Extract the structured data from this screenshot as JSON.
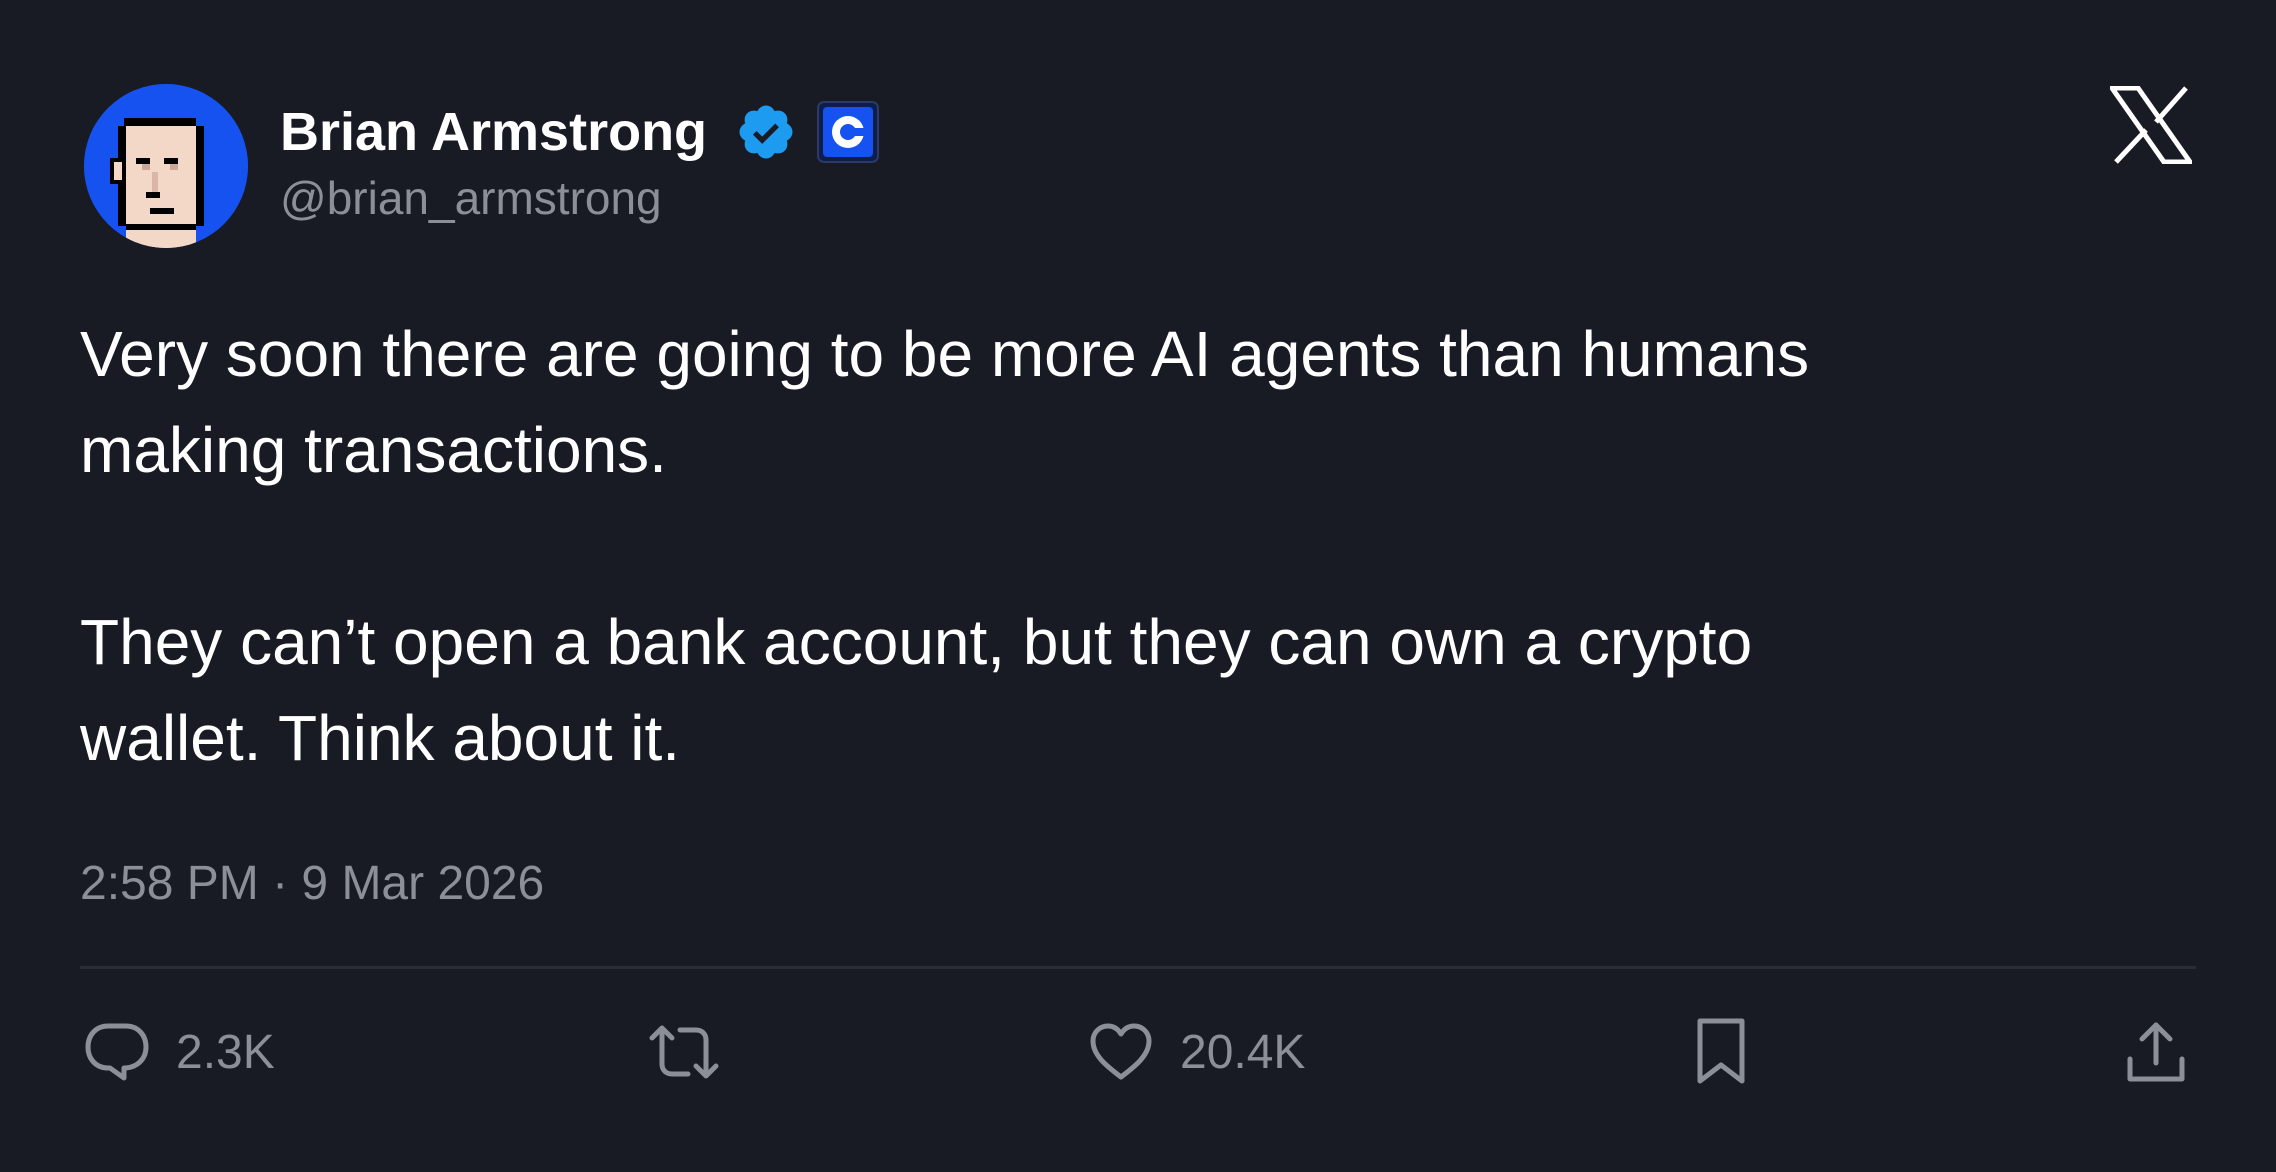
{
  "author": {
    "display_name": "Brian Armstrong",
    "handle": "@brian_armstrong",
    "avatar_icon": "pixel-portrait-avatar",
    "verified_icon": "verified-badge-icon",
    "affiliate_icon": "coinbase-logo-icon"
  },
  "brand_icon": "x-logo-icon",
  "tweet": {
    "paragraph_1": "Very soon there are going to be more AI agents than humans\nmaking transactions.",
    "paragraph_2": "They can’t open a bank account, but they can own a crypto\nwallet. Think about it.",
    "timestamp": "2:58 PM · 9 Mar 2026"
  },
  "actions": {
    "reply_count": "2.3K",
    "like_count": "20.4K",
    "reply_icon": "comment-icon",
    "retweet_icon": "retweet-icon",
    "like_icon": "heart-icon",
    "bookmark_icon": "bookmark-icon",
    "share_icon": "share-icon"
  },
  "colors": {
    "background": "#181b23",
    "text": "#ffffff",
    "muted": "#8b8f98",
    "verified": "#1d9bf0",
    "coinbase_blue": "#1652f0"
  }
}
